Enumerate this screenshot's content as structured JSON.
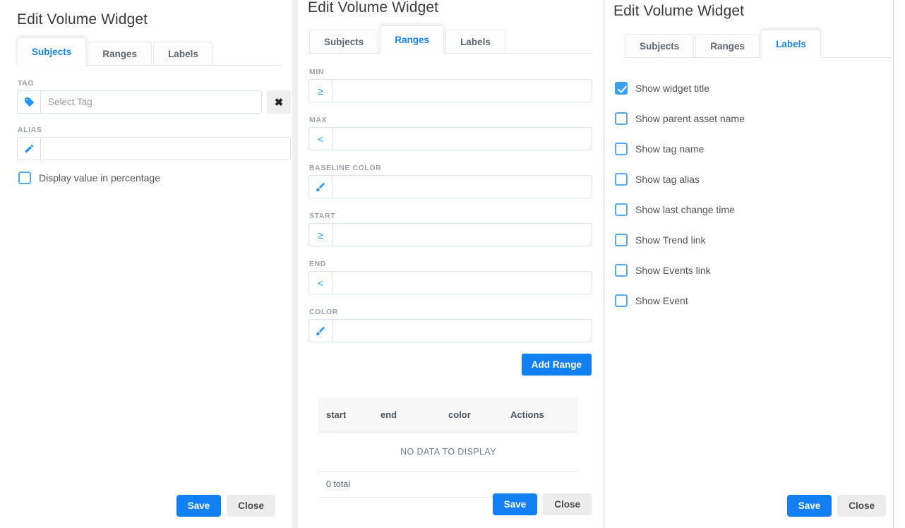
{
  "panels": {
    "left": {
      "title": "Edit Volume Widget",
      "tabs": [
        {
          "label": "Subjects",
          "active": true
        },
        {
          "label": "Ranges",
          "active": false
        },
        {
          "label": "Labels",
          "active": false
        }
      ],
      "tag": {
        "label": "TAG",
        "icon": "tag-icon",
        "value": "",
        "placeholder": "Select Tag",
        "clear_label": "✖"
      },
      "alias": {
        "label": "ALIAS",
        "icon": "pencil-icon",
        "value": "",
        "placeholder": ""
      },
      "percentage_checkbox": {
        "label": "Display value in percentage",
        "checked": false
      },
      "save_label": "Save",
      "close_label": "Close"
    },
    "middle": {
      "title": "Edit Volume Widget",
      "tabs": [
        {
          "label": "Subjects",
          "active": false
        },
        {
          "label": "Ranges",
          "active": true
        },
        {
          "label": "Labels",
          "active": false
        }
      ],
      "fields": [
        {
          "label": "MIN",
          "addon": "≥",
          "addon_icon": "greater-equal-icon",
          "value": "",
          "placeholder": ""
        },
        {
          "label": "MAX",
          "addon": "<",
          "addon_icon": "less-than-icon",
          "value": "",
          "placeholder": ""
        },
        {
          "label": "BASELINE COLOR",
          "addon": "",
          "addon_icon": "brush-icon",
          "value": "",
          "placeholder": ""
        },
        {
          "label": "START",
          "addon": "≥",
          "addon_icon": "greater-equal-icon",
          "value": "",
          "placeholder": ""
        },
        {
          "label": "END",
          "addon": "<",
          "addon_icon": "less-than-icon",
          "value": "",
          "placeholder": ""
        },
        {
          "label": "COLOR",
          "addon": "",
          "addon_icon": "brush-icon",
          "value": "",
          "placeholder": ""
        }
      ],
      "add_range_label": "Add Range",
      "table": {
        "columns": [
          "start",
          "end",
          "color",
          "Actions"
        ],
        "rows": [],
        "empty_message": "NO DATA TO DISPLAY",
        "total_text": "0 total"
      },
      "save_label": "Save",
      "close_label": "Close"
    },
    "right": {
      "title": "Edit Volume Widget",
      "tabs": [
        {
          "label": "Subjects",
          "active": false
        },
        {
          "label": "Ranges",
          "active": false
        },
        {
          "label": "Labels",
          "active": true
        }
      ],
      "checkboxes": [
        {
          "label": "Show widget title",
          "checked": true
        },
        {
          "label": "Show parent asset name",
          "checked": false
        },
        {
          "label": "Show tag name",
          "checked": false
        },
        {
          "label": "Show tag alias",
          "checked": false
        },
        {
          "label": "Show last change time",
          "checked": false
        },
        {
          "label": "Show Trend link",
          "checked": false
        },
        {
          "label": "Show Events link",
          "checked": false
        },
        {
          "label": "Show Event",
          "checked": false
        }
      ],
      "save_label": "Save",
      "close_label": "Close"
    }
  },
  "colors": {
    "accent": "#1280f3",
    "tab_active_text": "#1a82f7",
    "checkbox_border": "#53a8ef",
    "checkbox_checked": "#3aa0ed",
    "label_text": "#9aa3ad",
    "panel_bg": "#ffffff",
    "page_bg": "#f0f0f0"
  }
}
